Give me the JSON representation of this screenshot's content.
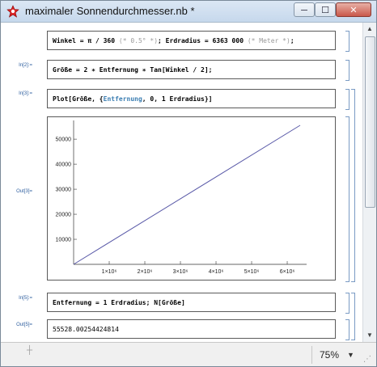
{
  "window": {
    "title": "maximaler Sonnendurchmesser.nb *",
    "controls": {
      "minimize": "─",
      "maximize": "☐",
      "close": "✕"
    }
  },
  "cells": {
    "c1": {
      "a": "Winkel = π / 360",
      "b": " (* 0.5° *)",
      "c": "; Erdradius = 6363 000",
      "d": " (* Meter *)",
      "e": ";"
    },
    "c2": {
      "label": "In[2]:=",
      "code": "Größe = 2 ∗ Entfernung ∗ Tan[Winkel / 2];"
    },
    "c3": {
      "label": "In[3]:=",
      "a": "Plot[Größe, {",
      "b": "Entfernung",
      "c": ", 0, 1 Erdradius}]"
    },
    "out3": {
      "label": "Out[3]="
    },
    "c5": {
      "label": "In[5]:=",
      "code": "Entfernung = 1 Erdradius; N[Größe]"
    },
    "out5": {
      "label": "Out[5]=",
      "value": "55528.00254424814"
    }
  },
  "chart_data": {
    "type": "line",
    "x": [
      0,
      6363000
    ],
    "y": [
      0,
      55528.00254424814
    ],
    "xlim": [
      0,
      6363000
    ],
    "ylim": [
      0,
      55528
    ],
    "xticks": [
      1000000,
      2000000,
      3000000,
      4000000,
      5000000,
      6000000
    ],
    "xtick_labels": [
      "1×10⁶",
      "2×10⁶",
      "3×10⁶",
      "4×10⁶",
      "5×10⁶",
      "6×10⁶"
    ],
    "yticks": [
      10000,
      20000,
      30000,
      40000,
      50000
    ],
    "ytick_labels": [
      "10000",
      "20000",
      "30000",
      "40000",
      "50000"
    ],
    "line_color": "#5a5aa8"
  },
  "status": {
    "zoom": "75%"
  },
  "colors": {
    "bracket": "#7a9bc4",
    "label": "#3060a0"
  }
}
